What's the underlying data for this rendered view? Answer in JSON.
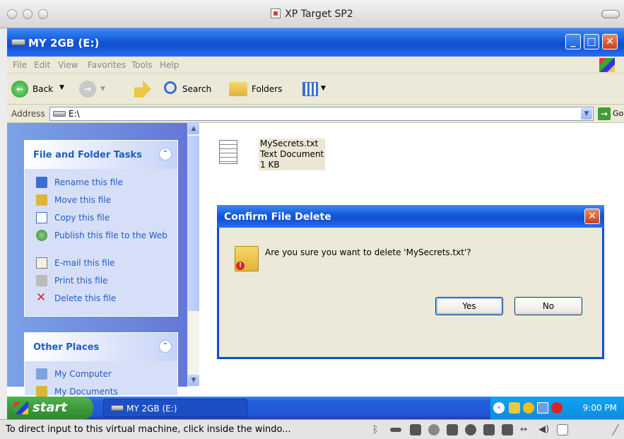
{
  "host_window": {
    "title": "XP Target SP2"
  },
  "explorer": {
    "title": "MY 2GB (E:)",
    "menu": [
      "File",
      "Edit",
      "View",
      "Favorites",
      "Tools",
      "Help"
    ],
    "toolbar": {
      "back": "Back",
      "search": "Search",
      "folders": "Folders"
    },
    "address": {
      "label": "Address",
      "value": "E:\\",
      "go": "Go"
    }
  },
  "tasks_panel": {
    "file_folder_tasks": {
      "title": "File and Folder Tasks",
      "items": [
        {
          "label": "Rename this file",
          "icon": "rename-icon"
        },
        {
          "label": "Move this file",
          "icon": "move-icon"
        },
        {
          "label": "Copy this file",
          "icon": "copy-icon"
        },
        {
          "label": "Publish this file to the Web",
          "icon": "globe-icon"
        },
        {
          "label": "E-mail this file",
          "icon": "email-icon"
        },
        {
          "label": "Print this file",
          "icon": "printer-icon"
        },
        {
          "label": "Delete this file",
          "icon": "delete-x-icon"
        }
      ]
    },
    "other_places": {
      "title": "Other Places",
      "items": [
        {
          "label": "My Computer",
          "icon": "computer-icon"
        },
        {
          "label": "My Documents",
          "icon": "folder-icon"
        }
      ]
    }
  },
  "file": {
    "name": "MySecrets.txt",
    "type": "Text Document",
    "size": "1 KB"
  },
  "dialog": {
    "title": "Confirm File Delete",
    "message": "Are you sure you want to delete 'MySecrets.txt'?",
    "yes": "Yes",
    "no": "No"
  },
  "taskbar": {
    "start": "start",
    "task": "MY 2GB (E:)",
    "clock": "9:00 PM"
  },
  "vm_status": {
    "message": "To direct input to this virtual machine, click inside the windo..."
  },
  "colors": {
    "xp_blue": "#0a4fd6",
    "task_link": "#215dc6",
    "start_green": "#3c9b3c"
  }
}
